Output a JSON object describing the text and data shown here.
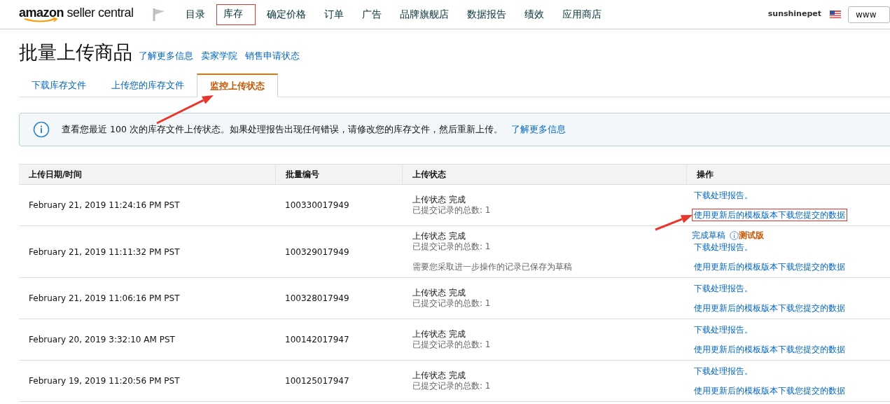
{
  "header": {
    "logo": "amazon seller central",
    "nav": [
      {
        "label": "目录",
        "highlighted": false
      },
      {
        "label": "库存",
        "highlighted": true
      },
      {
        "label": "确定价格",
        "highlighted": false
      },
      {
        "label": "订单",
        "highlighted": false
      },
      {
        "label": "广告",
        "highlighted": false
      },
      {
        "label": "品牌旗舰店",
        "highlighted": false
      },
      {
        "label": "数据报告",
        "highlighted": false
      },
      {
        "label": "绩效",
        "highlighted": false
      },
      {
        "label": "应用商店",
        "highlighted": false
      }
    ],
    "account": "sunshinepet",
    "search": {
      "value": "www"
    }
  },
  "page": {
    "title": "批量上传商品",
    "links": [
      "了解更多信息",
      "卖家学院",
      "销售申请状态"
    ]
  },
  "tabs": [
    {
      "label": "下载库存文件",
      "selected": false
    },
    {
      "label": "上传您的库存文件",
      "selected": false
    },
    {
      "label": "监控上传状态",
      "selected": true
    }
  ],
  "info": {
    "text": "查看您最近 100 次的库存文件上传状态。如果处理报告出现任何错误，请修改您的库存文件，然后重新上传。",
    "link": "了解更多信息"
  },
  "table": {
    "columns": [
      "上传日期/时间",
      "批量编号",
      "上传状态",
      "操作"
    ],
    "rows": [
      {
        "date": "February 21, 2019 11:24:16 PM PST",
        "batch": "100330017949",
        "status": "上传状态 完成",
        "count": "已提交记录的总数: 1",
        "actions": [
          {
            "label": "下载处理报告。",
            "highlighted": false
          },
          {
            "label": "使用更新后的模板版本下载您提交的数据",
            "highlighted": true
          }
        ]
      },
      {
        "date": "February 21, 2019 11:11:32 PM PST",
        "batch": "100329017949",
        "status": "上传状态 完成",
        "count": "已提交记录的总数: 1",
        "note": "需要您采取进一步操作的记录已保存为草稿",
        "draft": {
          "label": "完成草稿",
          "badge": "测试版"
        },
        "actions": [
          {
            "label": "下载处理报告。",
            "highlighted": false
          },
          {
            "label": "使用更新后的模板版本下载您提交的数据",
            "highlighted": false
          }
        ]
      },
      {
        "date": "February 21, 2019 11:06:16 PM PST",
        "batch": "100328017949",
        "status": "上传状态 完成",
        "count": "已提交记录的总数: 1",
        "actions": [
          {
            "label": "下载处理报告。",
            "highlighted": false
          },
          {
            "label": "使用更新后的模板版本下载您提交的数据",
            "highlighted": false
          }
        ]
      },
      {
        "date": "February 20, 2019 3:32:10 AM PST",
        "batch": "100142017947",
        "status": "上传状态 完成",
        "count": "已提交记录的总数: 1",
        "actions": [
          {
            "label": "下载处理报告。",
            "highlighted": false
          },
          {
            "label": "使用更新后的模板版本下载您提交的数据",
            "highlighted": false
          }
        ]
      },
      {
        "date": "February 19, 2019 11:20:56 PM PST",
        "batch": "100125017947",
        "status": "上传状态 完成",
        "count": "已提交记录的总数: 1",
        "actions": [
          {
            "label": "下载处理报告。",
            "highlighted": false
          },
          {
            "label": "使用更新后的模板版本下载您提交的数据",
            "highlighted": false
          }
        ]
      }
    ]
  }
}
